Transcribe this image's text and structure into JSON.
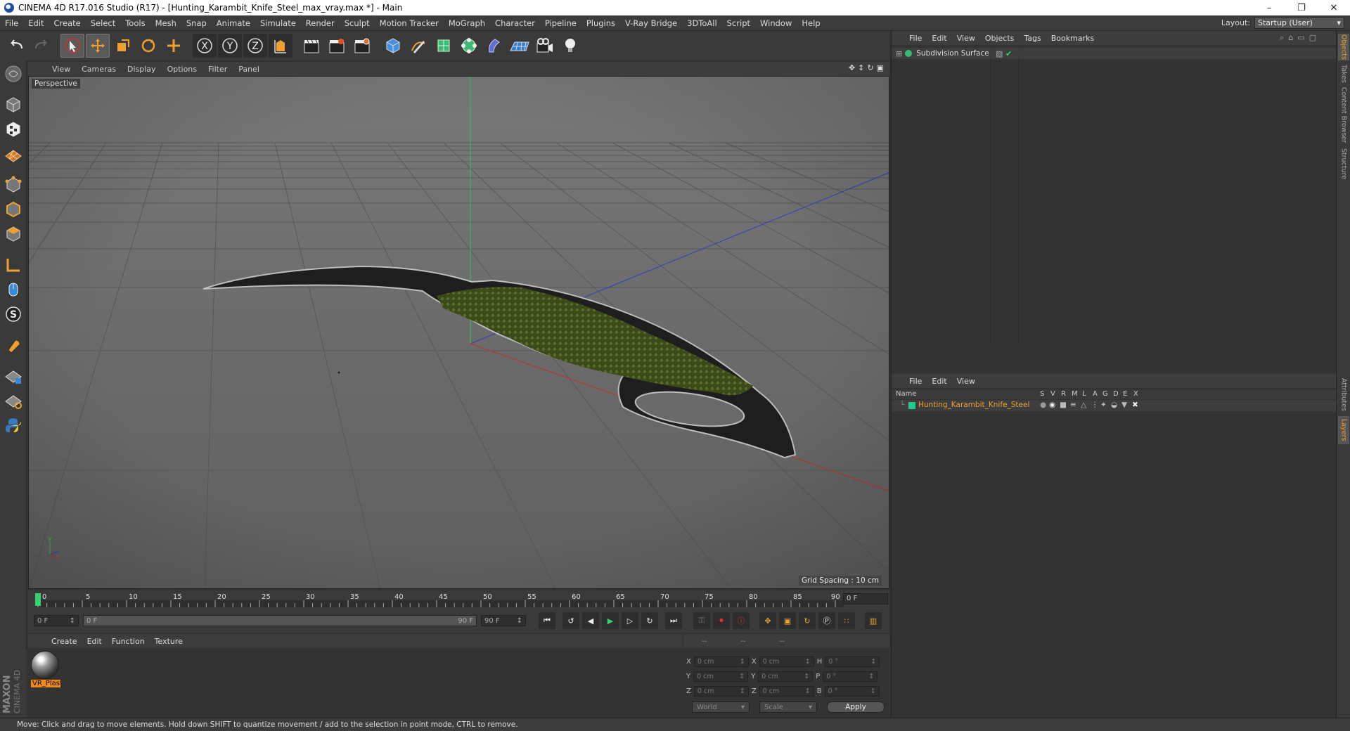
{
  "window": {
    "title": "CINEMA 4D R17.016 Studio (R17) - [Hunting_Karambit_Knife_Steel_max_vray.max *] - Main",
    "controls": [
      "minimize-icon",
      "restore-icon",
      "close-icon"
    ]
  },
  "menubar": {
    "items": [
      "File",
      "Edit",
      "Create",
      "Select",
      "Tools",
      "Mesh",
      "Snap",
      "Animate",
      "Simulate",
      "Render",
      "Sculpt",
      "Motion Tracker",
      "MoGraph",
      "Character",
      "Pipeline",
      "Plugins",
      "V-Ray Bridge",
      "3DToAll",
      "Script",
      "Window",
      "Help"
    ],
    "layout_label": "Layout:",
    "layout_value": "Startup (User)"
  },
  "toolbar": {
    "axis_labels": [
      "X",
      "Y",
      "Z"
    ]
  },
  "viewport": {
    "menu": [
      "View",
      "Cameras",
      "Display",
      "Options",
      "Filter",
      "Panel"
    ],
    "camera_label": "Perspective",
    "grid_spacing": "Grid Spacing : 10 cm",
    "axis_colors": {
      "x": "#c83232",
      "y": "#32b432",
      "z": "#3232c8"
    }
  },
  "timeline": {
    "ticks": [
      "0",
      "5",
      "10",
      "15",
      "20",
      "25",
      "30",
      "35",
      "40",
      "45",
      "50",
      "55",
      "60",
      "65",
      "70",
      "75",
      "80",
      "85",
      "90"
    ],
    "current_frame": "0 F",
    "start_field": "0 F",
    "range_start": "0 F",
    "range_end": "90 F",
    "end_field": "90 F"
  },
  "material_manager": {
    "menu": [
      "Create",
      "Edit",
      "Function",
      "Texture"
    ],
    "materials": [
      {
        "name": "VR_Plast"
      }
    ]
  },
  "coordinates": {
    "headers": [
      "--",
      "--",
      "--"
    ],
    "rows": [
      {
        "axis": "X",
        "pos": "0 cm",
        "axis2": "X",
        "size": "0 cm",
        "axis3": "H",
        "rot": "0 °"
      },
      {
        "axis": "Y",
        "pos": "0 cm",
        "axis2": "Y",
        "size": "0 cm",
        "axis3": "P",
        "rot": "0 °"
      },
      {
        "axis": "Z",
        "pos": "0 cm",
        "axis2": "Z",
        "size": "0 cm",
        "axis3": "B",
        "rot": "0 °"
      }
    ],
    "space_dropdown": "World",
    "mode_dropdown": "Scale",
    "apply_label": "Apply"
  },
  "object_manager": {
    "menu": [
      "File",
      "Edit",
      "View",
      "Objects",
      "Tags",
      "Bookmarks"
    ],
    "objects": [
      {
        "name": "Subdivision Surface"
      }
    ]
  },
  "layer_manager": {
    "menu": [
      "File",
      "Edit",
      "View"
    ],
    "columns": [
      "Name",
      "S",
      "V",
      "R",
      "M",
      "L",
      "A",
      "G",
      "D",
      "E",
      "X"
    ],
    "layers": [
      {
        "name": "Hunting_Karambit_Knife_Steel",
        "color": "#22c88c"
      }
    ]
  },
  "side_tabs": [
    "Objects",
    "Takes",
    "Content Browser",
    "Structure",
    "Attributes",
    "Layers"
  ],
  "status": {
    "text": "Move: Click and drag to move elements. Hold down SHIFT to quantize movement / add to the selection in point mode, CTRL to remove."
  },
  "branding": {
    "maxon": "MAXON",
    "product": "CINEMA 4D"
  },
  "accent_color": "#f08a10"
}
